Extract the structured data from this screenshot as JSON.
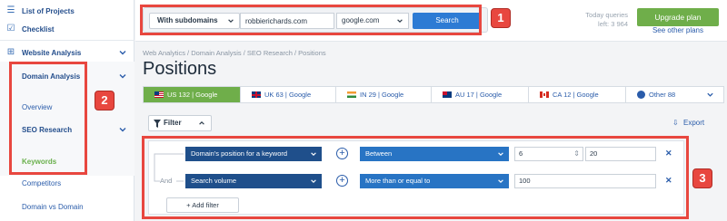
{
  "sidebar": {
    "items": [
      {
        "label": "List of Projects"
      },
      {
        "label": "Checklist"
      },
      {
        "label": "Website Analysis"
      },
      {
        "label": "Domain Analysis"
      },
      {
        "label": "Overview"
      },
      {
        "label": "SEO Research"
      },
      {
        "label": "Keywords"
      },
      {
        "label": "Competitors"
      },
      {
        "label": "Domain vs Domain"
      }
    ]
  },
  "topbar": {
    "mode_select": "With subdomains",
    "domain_value": "robbierichards.com",
    "database_select": "google.com",
    "search_label": "Search",
    "queries_label": "Today queries",
    "queries_left": "left: 3 964",
    "upgrade_label": "Upgrade plan",
    "other_plans_label": "See other plans"
  },
  "main": {
    "breadcrumb": "Web Analytics / Domain Analysis / SEO Research / Positions",
    "title": "Positions",
    "tabs": [
      {
        "label": "US 132 | Google",
        "flag": "us"
      },
      {
        "label": "UK 63 | Google",
        "flag": "uk"
      },
      {
        "label": "IN 29 | Google",
        "flag": "in"
      },
      {
        "label": "AU 17 | Google",
        "flag": "au"
      },
      {
        "label": "CA 12 | Google",
        "flag": "ca"
      },
      {
        "label": "Other 88",
        "flag": "globe"
      }
    ],
    "filter_label": "Filter",
    "export_label": "Export"
  },
  "filters": {
    "rows": [
      {
        "param": "Domain's position for a keyword",
        "operator": "Between",
        "value_from": "6",
        "value_to": "20"
      },
      {
        "connector": "And",
        "param": "Search volume",
        "operator": "More than or equal to",
        "value_from": "100"
      }
    ],
    "add_label": "+ Add filter"
  },
  "annotations": [
    "1",
    "2",
    "3"
  ],
  "colors": {
    "accent_green": "#6fae4a",
    "primary_blue": "#2d7bd4",
    "annotation_red": "#e8473f"
  }
}
